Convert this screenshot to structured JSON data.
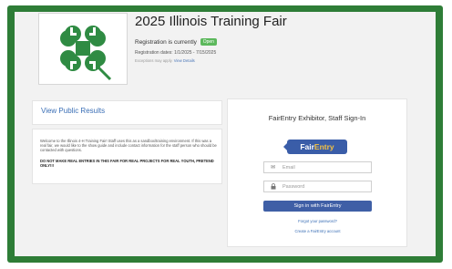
{
  "header": {
    "title": "2025 Illinois Training Fair",
    "registration_label": "Registration is currently",
    "registration_status": "Open",
    "registration_dates": "Registration dates: 1/1/2025 - 7/15/2025",
    "registration_note": "Exceptions may apply.",
    "view_details": "View Details"
  },
  "results": {
    "link_label": "View Public Results"
  },
  "info": {
    "text": "Welcome to the Illinois 4-H Training Fair! Staff uses this as a sandbox/training environment. If this was a real fair, we would like to the show guide and include contact information for the staff person who should be contacted with questions.",
    "warning": "DO NOT MAKE REAL ENTRIES IN THIS FAIR FOR REAL PROJECTS FOR REAL YOUTH, PRETEND ONLY!!!"
  },
  "signin": {
    "title": "FairEntry Exhibitor, Staff Sign-In",
    "logo_fair": "Fair",
    "logo_entry": "Entry",
    "email_placeholder": "Email",
    "password_placeholder": "Password",
    "button_label": "Sign in with FairEntry",
    "forgot_label": "Forgot your password?",
    "create_label": "Create a FairEntry account"
  },
  "icons": {
    "logo": "4h-clover-logo",
    "email": "envelope-icon",
    "password": "lock-icon"
  },
  "colors": {
    "frame": "#2e7d37",
    "clover": "#2f8b43",
    "status_badge": "#5cb85c",
    "button": "#3f5fa6",
    "link": "#3b6fb6",
    "fairentry_entry": "#f4c242"
  }
}
